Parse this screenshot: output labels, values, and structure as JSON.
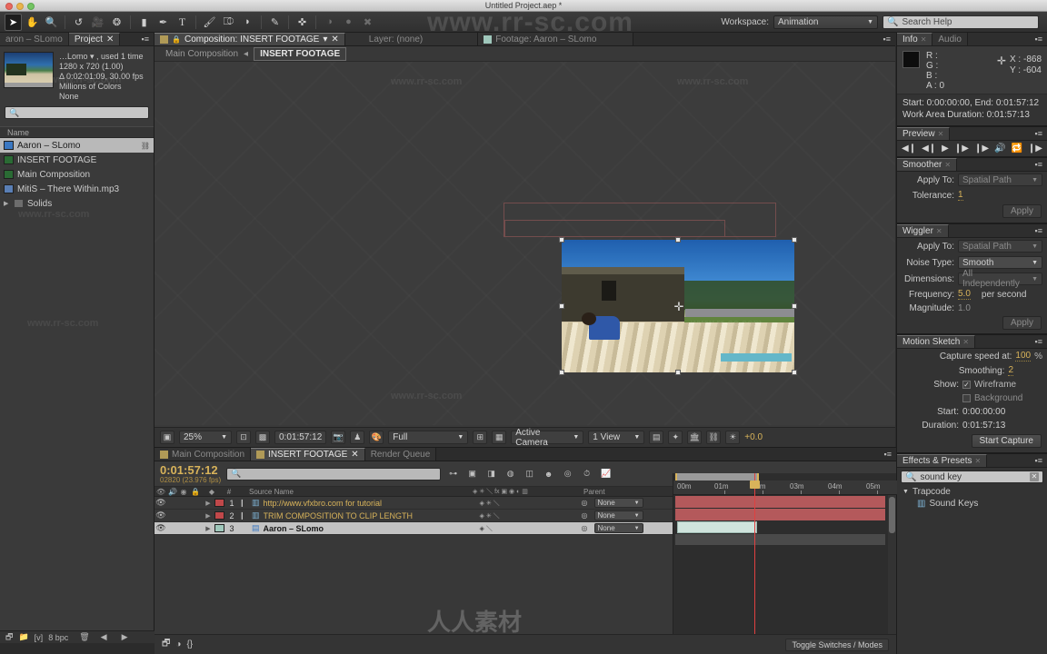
{
  "window": {
    "title": "Untitled Project.aep *"
  },
  "watermarks": {
    "top": "www.rr-sc.com",
    "bottom": "人人素材",
    "small": "www.rr-sc.com"
  },
  "toolbar": {
    "tools": [
      {
        "name": "selection-tool",
        "glyph": "➤",
        "selected": true
      },
      {
        "name": "hand-tool",
        "glyph": "✋",
        "selected": false
      },
      {
        "name": "zoom-tool",
        "glyph": "🔍",
        "selected": false
      },
      {
        "name": "rotation-tool",
        "glyph": "↺",
        "selected": false
      },
      {
        "name": "camera-tool",
        "glyph": "🎥",
        "selected": false
      },
      {
        "name": "pan-behind-tool",
        "glyph": "❂",
        "selected": false
      },
      {
        "name": "shape-tool",
        "glyph": "▮",
        "selected": false
      },
      {
        "name": "pen-tool",
        "glyph": "✒",
        "selected": false
      },
      {
        "name": "type-tool",
        "glyph": "T",
        "selected": false
      },
      {
        "name": "brush-tool",
        "glyph": "🖌",
        "selected": false
      },
      {
        "name": "clone-stamp-tool",
        "glyph": "⎄",
        "selected": false
      },
      {
        "name": "eraser-tool",
        "glyph": "◗",
        "selected": false
      },
      {
        "name": "roto-brush-tool",
        "glyph": "✎",
        "selected": false
      },
      {
        "name": "puppet-pin-tool",
        "glyph": "✜",
        "selected": false
      }
    ],
    "workspace_label": "Workspace:",
    "workspace_value": "Animation",
    "search_placeholder": "Search Help"
  },
  "project": {
    "tabs": [
      {
        "label": "aron – SLomo",
        "active": false
      },
      {
        "label": "Project",
        "active": true
      }
    ],
    "info": {
      "name": "…Lomo ▾ , used 1 time",
      "dimensions": "1280 x 720 (1.00)",
      "duration": "Δ 0:02:01:09, 30.00 fps",
      "color": "Millions of Colors",
      "audio": "None"
    },
    "search_placeholder": "",
    "column_name": "Name",
    "items": [
      {
        "label": "Aaron – SLomo",
        "icon": "footage-icon",
        "selected": true,
        "folder": false
      },
      {
        "label": "INSERT FOOTAGE",
        "icon": "composition-icon",
        "selected": false,
        "folder": false
      },
      {
        "label": "Main Composition",
        "icon": "composition-icon",
        "selected": false,
        "folder": false
      },
      {
        "label": "MitiS – There Within.mp3",
        "icon": "audio-icon",
        "selected": false,
        "folder": false
      },
      {
        "label": "Solids",
        "icon": "folder-icon",
        "selected": false,
        "folder": true
      }
    ],
    "footer": {
      "bit_depth": "8 bpc"
    }
  },
  "viewer": {
    "tabs": [
      {
        "label": "Composition: INSERT FOOTAGE",
        "active": true
      },
      {
        "label": "Layer: (none)",
        "active": false
      },
      {
        "label": "Footage: Aaron – SLomo",
        "active": false
      }
    ],
    "breadcrumb": [
      {
        "label": "Main Composition",
        "current": false
      },
      {
        "label": "INSERT FOOTAGE",
        "current": true
      }
    ],
    "toolbar": {
      "zoom": "25%",
      "timecode": "0:01:57:12",
      "resolution": "Full",
      "camera": "Active Camera",
      "views": "1 View",
      "exposure": "+0.0"
    }
  },
  "info_panel": {
    "tabs": [
      {
        "label": "Info",
        "active": true
      },
      {
        "label": "Audio",
        "active": false
      }
    ],
    "r_label": "R :",
    "r_value": "",
    "g_label": "G :",
    "g_value": "",
    "b_label": "B :",
    "b_value": "",
    "a_label": "A :",
    "a_value": "0",
    "x_label": "X :",
    "x_value": "-868",
    "y_label": "Y :",
    "y_value": "-604",
    "range": "Start: 0:00:00:00, End: 0:01:57:12",
    "work_area": "Work Area Duration: 0:01:57:13"
  },
  "preview_panel": {
    "tab": "Preview",
    "buttons": [
      "first-frame",
      "prev-frame",
      "play",
      "next-frame",
      "last-frame",
      "audio",
      "loop",
      "ram-preview"
    ]
  },
  "smoother_panel": {
    "tab": "Smoother",
    "apply_to_label": "Apply To:",
    "apply_to_value": "Spatial Path",
    "tolerance_label": "Tolerance:",
    "tolerance_value": "1",
    "apply_button": "Apply"
  },
  "wiggler_panel": {
    "tab": "Wiggler",
    "apply_to_label": "Apply To:",
    "apply_to_value": "Spatial Path",
    "noise_type_label": "Noise Type:",
    "noise_type_value": "Smooth",
    "dimensions_label": "Dimensions:",
    "dimensions_value": "All Independently",
    "frequency_label": "Frequency:",
    "frequency_value": "5.0",
    "frequency_unit": "per second",
    "magnitude_label": "Magnitude:",
    "magnitude_value": "1.0",
    "apply_button": "Apply"
  },
  "motion_sketch_panel": {
    "tab": "Motion Sketch",
    "capture_label": "Capture speed at:",
    "capture_value": "100",
    "capture_unit": "%",
    "smoothing_label": "Smoothing:",
    "smoothing_value": "2",
    "show_label": "Show:",
    "wireframe_label": "Wireframe",
    "wireframe_checked": true,
    "background_label": "Background",
    "background_checked": false,
    "start_label": "Start:",
    "start_value": "0:00:00:00",
    "duration_label": "Duration:",
    "duration_value": "0:01:57:13",
    "start_capture_button": "Start Capture"
  },
  "effects_panel": {
    "tab": "Effects & Presets",
    "search_value": "sound key",
    "group": "Trapcode",
    "items": [
      "Sound Keys"
    ]
  },
  "timeline": {
    "tabs": [
      {
        "label": "Main Composition",
        "active": false
      },
      {
        "label": "INSERT FOOTAGE",
        "active": true
      },
      {
        "label": "Render Queue",
        "active": false
      }
    ],
    "timecode": "0:01:57:12",
    "frames": "02820 (23.976 fps)",
    "search_placeholder": "",
    "columns": {
      "source_name": "Source Name",
      "parent": "Parent",
      "num": "#"
    },
    "layers": [
      {
        "index": "1",
        "name": "http://www.vfxbro.com for tutorial",
        "color": "red",
        "parent": "None",
        "selected": false,
        "bar": "red"
      },
      {
        "index": "2",
        "name": "TRIM COMPOSITION TO CLIP LENGTH",
        "color": "red",
        "parent": "None",
        "selected": false,
        "bar": "red"
      },
      {
        "index": "3",
        "name": "Aaron – SLomo",
        "color": "green",
        "parent": "None",
        "selected": true,
        "bar": "green"
      }
    ],
    "ruler_labels": [
      "00m",
      "01m",
      "02m",
      "03m",
      "04m",
      "05m"
    ],
    "footer_toggle": "Toggle Switches / Modes"
  },
  "colors": {
    "accent": "#d8b35a",
    "panel_bg": "#3a3a3a",
    "layer_red": "#c0484a",
    "layer_green": "#9fc8bb"
  }
}
